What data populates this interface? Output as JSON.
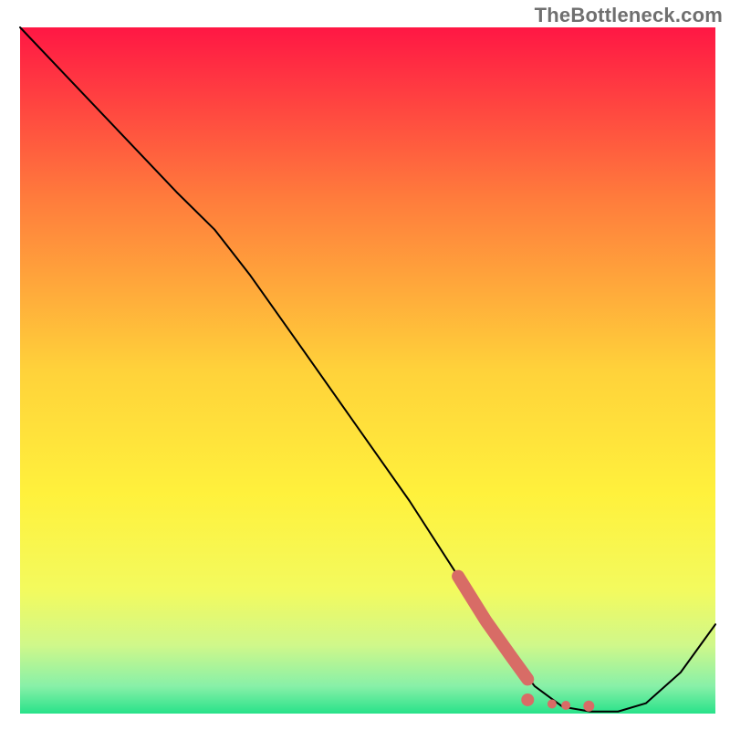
{
  "watermark": {
    "text": "TheBottleneck.com"
  },
  "chart_data": {
    "type": "line",
    "title": "",
    "xlabel": "",
    "ylabel": "",
    "xlim": [
      0,
      100
    ],
    "ylim": [
      0,
      100
    ],
    "grid": false,
    "legend": false,
    "background_gradient": {
      "direction": "vertical",
      "stops": [
        {
          "pos": 0.0,
          "color": "#ff1744"
        },
        {
          "pos": 0.25,
          "color": "#ff7c3c"
        },
        {
          "pos": 0.5,
          "color": "#ffd23a"
        },
        {
          "pos": 0.68,
          "color": "#fff13c"
        },
        {
          "pos": 0.82,
          "color": "#f3fa5e"
        },
        {
          "pos": 0.9,
          "color": "#d0f88a"
        },
        {
          "pos": 0.96,
          "color": "#88f0a8"
        },
        {
          "pos": 1.0,
          "color": "#28e28a"
        }
      ]
    },
    "series": [
      {
        "name": "curve",
        "color": "#000000",
        "width": 2,
        "x": [
          0.0,
          7.5,
          15.0,
          22.5,
          28.0,
          33.0,
          40.0,
          48.0,
          56.0,
          63.0,
          67.0,
          70.5,
          74.0,
          78.0,
          82.0,
          86.0,
          90.0,
          95.0,
          100.0
        ],
        "y": [
          100.0,
          92.0,
          84.0,
          76.0,
          70.5,
          64.0,
          54.0,
          42.5,
          31.0,
          20.0,
          13.5,
          8.5,
          4.0,
          1.0,
          0.3,
          0.3,
          1.5,
          6.0,
          13.0
        ]
      },
      {
        "name": "highlight",
        "color": "#d86c66",
        "width": 14,
        "cap": "round",
        "x": [
          63.0,
          67.0,
          70.5,
          73.0
        ],
        "y": [
          20.0,
          13.5,
          8.5,
          5.0
        ]
      }
    ],
    "annotations": [
      {
        "kind": "highlight-tail-dot",
        "x": 73.0,
        "y": 2.0,
        "r": 7,
        "color": "#d86c66"
      },
      {
        "kind": "dot",
        "x": 76.5,
        "y": 1.4,
        "r": 5,
        "color": "#d86c66"
      },
      {
        "kind": "dot",
        "x": 78.5,
        "y": 1.2,
        "r": 5,
        "color": "#d86c66"
      },
      {
        "kind": "dot",
        "x": 81.8,
        "y": 1.1,
        "r": 6,
        "color": "#d86c66"
      }
    ]
  }
}
